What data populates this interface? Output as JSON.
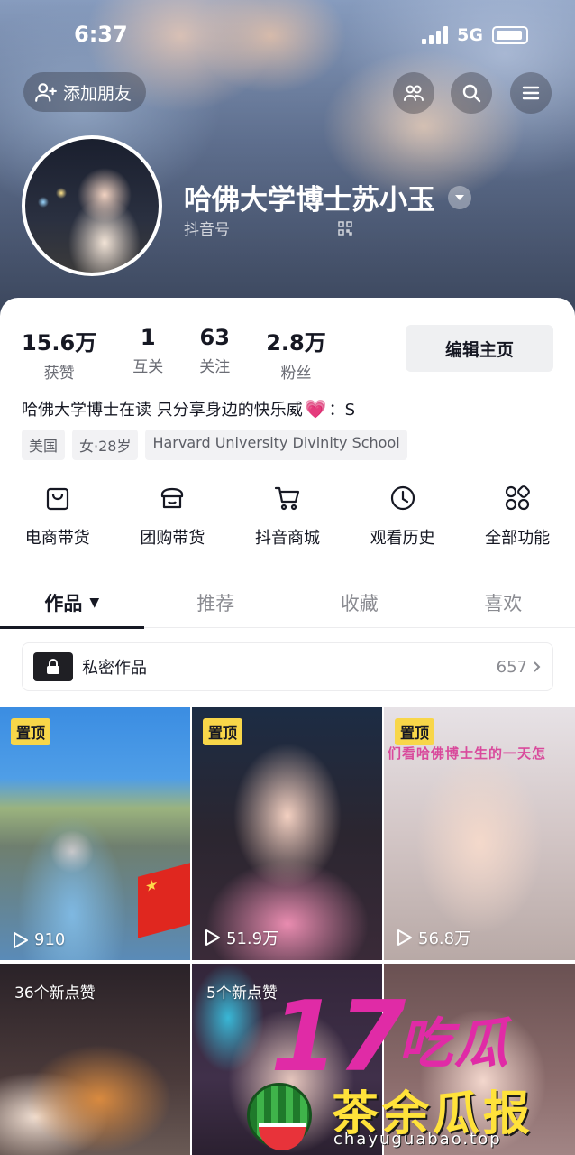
{
  "status_bar": {
    "time": "6:37",
    "network": "5G"
  },
  "header": {
    "add_friend": "添加朋友",
    "nickname": "哈佛大学博士苏小玉",
    "douyin_id_label": "抖音号"
  },
  "stats": [
    {
      "value": "15.6万",
      "label": "获赞"
    },
    {
      "value": "1",
      "label": "互关"
    },
    {
      "value": "63",
      "label": "关注"
    },
    {
      "value": "2.8万",
      "label": "粉丝"
    }
  ],
  "edit_profile": "编辑主页",
  "bio": {
    "text": "哈佛大学博士在读 只分享身边的快乐威",
    "suffix": "：S"
  },
  "tags": [
    "美国",
    "女·28岁",
    "Harvard University Divinity School"
  ],
  "features": [
    {
      "label": "电商带货",
      "icon": "shopping-bag-icon"
    },
    {
      "label": "团购带货",
      "icon": "group-buy-icon"
    },
    {
      "label": "抖音商城",
      "icon": "cart-icon"
    },
    {
      "label": "观看历史",
      "icon": "clock-icon"
    },
    {
      "label": "全部功能",
      "icon": "grid-icon"
    }
  ],
  "tabs": [
    "作品",
    "推荐",
    "收藏",
    "喜欢"
  ],
  "private_works": {
    "label": "私密作品",
    "count": "657"
  },
  "videos": [
    {
      "pinned": "置顶",
      "views": "910"
    },
    {
      "pinned": "置顶",
      "views": "51.9万"
    },
    {
      "pinned": "置顶",
      "views": "56.8万",
      "overlay": "们看哈佛博士生的一天怎"
    },
    {
      "new_likes": "36个新点赞"
    },
    {
      "new_likes": "5个新点赞"
    },
    {}
  ],
  "watermark": {
    "top": "17吃瓜",
    "main": "茶余瓜报",
    "url": "chayuguabao.top"
  },
  "colors": {
    "accent_pink": "#e02ba6",
    "pin_yellow": "#f8d649",
    "text_primary": "#161823",
    "text_secondary": "#8a8b91"
  }
}
